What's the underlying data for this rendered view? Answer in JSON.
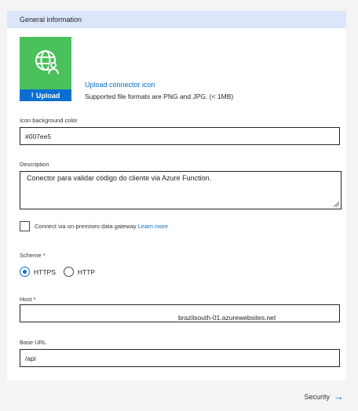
{
  "section": {
    "title": "General information"
  },
  "icon_tile": {
    "background": "#4ac15b",
    "icon": "globe-user-icon",
    "upload_label": "Upload",
    "upload_arrow": "⭱"
  },
  "upload": {
    "link_text": "Upload connector icon",
    "hint": "Supported file formats are PNG and JPG. (< 1MB)"
  },
  "icon_background": {
    "label": "Icon background color",
    "value": "#007ee5"
  },
  "description": {
    "label": "Description",
    "value": "Conector para validar código do cliente via Azure Function."
  },
  "gateway": {
    "label": "Connect via on-premises data gateway",
    "link": "Learn more",
    "checked": false
  },
  "scheme": {
    "label": "Scheme *",
    "options": [
      "HTTPS",
      "HTTP"
    ],
    "selected": "HTTPS"
  },
  "host": {
    "label": "Host *",
    "value": "brazilsouth-01.azurewebsites.net"
  },
  "base_url": {
    "label": "Base URL",
    "value": "/api"
  },
  "footer": {
    "next_label": "Security",
    "next_icon": "arrow-right-icon"
  },
  "colors": {
    "header_bg": "#dce6fa",
    "accent": "#0a6fd1",
    "link": "#0b6bc5"
  }
}
